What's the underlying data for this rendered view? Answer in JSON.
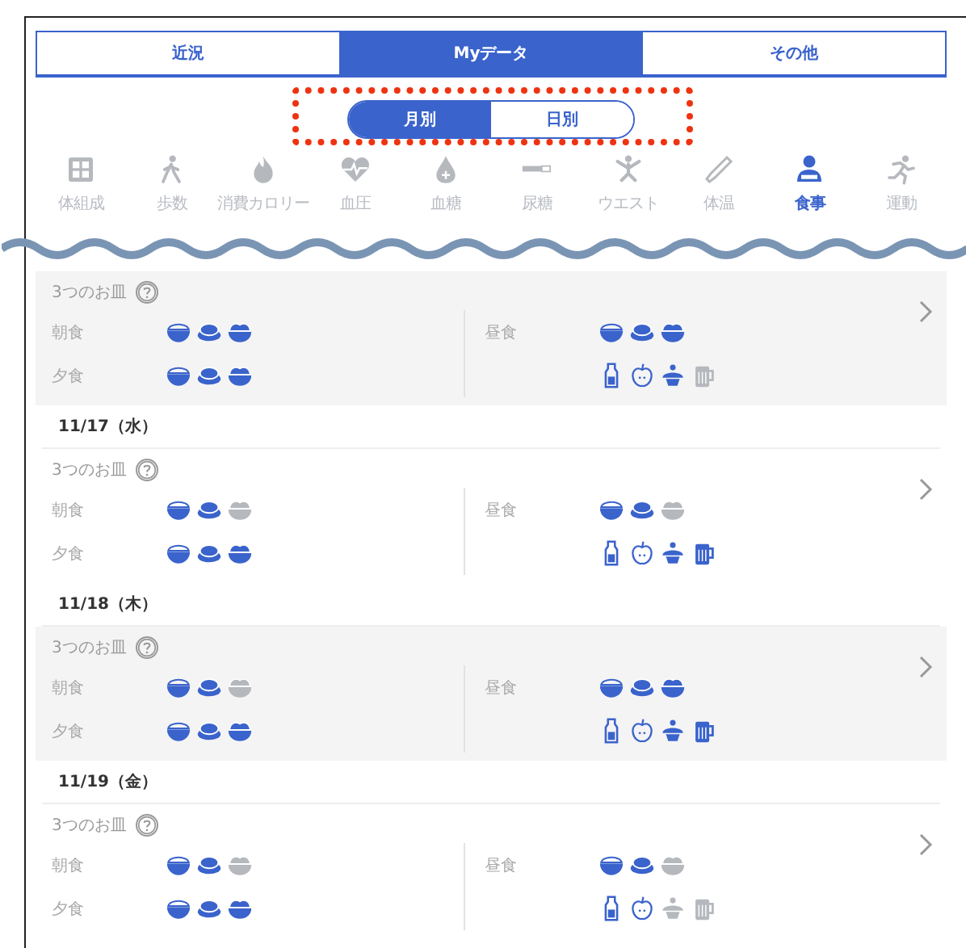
{
  "tabs": [
    {
      "label": "近況",
      "selected": false
    },
    {
      "label": "Myデータ",
      "selected": true
    },
    {
      "label": "その他",
      "selected": false
    }
  ],
  "period_toggle": [
    {
      "label": "月別",
      "selected": true
    },
    {
      "label": "日別",
      "selected": false
    }
  ],
  "categories": [
    {
      "label": "体組成",
      "kind": "scale",
      "selected": false
    },
    {
      "label": "歩数",
      "kind": "walk",
      "selected": false
    },
    {
      "label": "消費カロリー",
      "kind": "flame",
      "selected": false
    },
    {
      "label": "血圧",
      "kind": "heart",
      "selected": false
    },
    {
      "label": "血糖",
      "kind": "drop",
      "selected": false
    },
    {
      "label": "尿糖",
      "kind": "strip",
      "selected": false
    },
    {
      "label": "ウエスト",
      "kind": "waist",
      "selected": false
    },
    {
      "label": "体温",
      "kind": "thermo",
      "selected": false
    },
    {
      "label": "食事",
      "kind": "meal",
      "selected": true
    },
    {
      "label": "運動",
      "kind": "run",
      "selected": false
    }
  ],
  "days": [
    {
      "section_label": "3つのお皿",
      "breakfast": {
        "label": "朝食",
        "dishes": [
          {
            "kind": "rice",
            "on": true
          },
          {
            "kind": "main",
            "on": true
          },
          {
            "kind": "side",
            "on": true
          }
        ]
      },
      "lunch": {
        "label": "昼食",
        "dishes": [
          {
            "kind": "rice",
            "on": true
          },
          {
            "kind": "main",
            "on": true
          },
          {
            "kind": "side",
            "on": true
          }
        ]
      },
      "dinner": {
        "label": "夕食",
        "dishes": [
          {
            "kind": "rice",
            "on": true
          },
          {
            "kind": "main",
            "on": true
          },
          {
            "kind": "side",
            "on": true
          }
        ]
      },
      "extras": [
        {
          "kind": "milk",
          "on": true
        },
        {
          "kind": "fruit",
          "on": true
        },
        {
          "kind": "sweets",
          "on": true
        },
        {
          "kind": "alcohol",
          "on": false
        }
      ]
    },
    {
      "date": "11/17（水）",
      "section_label": "3つのお皿",
      "breakfast": {
        "label": "朝食",
        "dishes": [
          {
            "kind": "rice",
            "on": true
          },
          {
            "kind": "main",
            "on": true
          },
          {
            "kind": "side",
            "on": false
          }
        ]
      },
      "lunch": {
        "label": "昼食",
        "dishes": [
          {
            "kind": "rice",
            "on": true
          },
          {
            "kind": "main",
            "on": true
          },
          {
            "kind": "side",
            "on": false
          }
        ]
      },
      "dinner": {
        "label": "夕食",
        "dishes": [
          {
            "kind": "rice",
            "on": true
          },
          {
            "kind": "main",
            "on": true
          },
          {
            "kind": "side",
            "on": true
          }
        ]
      },
      "extras": [
        {
          "kind": "milk",
          "on": true
        },
        {
          "kind": "fruit",
          "on": true
        },
        {
          "kind": "sweets",
          "on": true
        },
        {
          "kind": "alcohol",
          "on": true
        }
      ]
    },
    {
      "date": "11/18（木）",
      "section_label": "3つのお皿",
      "breakfast": {
        "label": "朝食",
        "dishes": [
          {
            "kind": "rice",
            "on": true
          },
          {
            "kind": "main",
            "on": true
          },
          {
            "kind": "side",
            "on": false
          }
        ]
      },
      "lunch": {
        "label": "昼食",
        "dishes": [
          {
            "kind": "rice",
            "on": true
          },
          {
            "kind": "main",
            "on": true
          },
          {
            "kind": "side",
            "on": true
          }
        ]
      },
      "dinner": {
        "label": "夕食",
        "dishes": [
          {
            "kind": "rice",
            "on": true
          },
          {
            "kind": "main",
            "on": true
          },
          {
            "kind": "side",
            "on": true
          }
        ]
      },
      "extras": [
        {
          "kind": "milk",
          "on": true
        },
        {
          "kind": "fruit",
          "on": true
        },
        {
          "kind": "sweets",
          "on": true
        },
        {
          "kind": "alcohol",
          "on": true
        }
      ]
    },
    {
      "date": "11/19（金）",
      "section_label": "3つのお皿",
      "breakfast": {
        "label": "朝食",
        "dishes": [
          {
            "kind": "rice",
            "on": true
          },
          {
            "kind": "main",
            "on": true
          },
          {
            "kind": "side",
            "on": false
          }
        ]
      },
      "lunch": {
        "label": "昼食",
        "dishes": [
          {
            "kind": "rice",
            "on": true
          },
          {
            "kind": "main",
            "on": true
          },
          {
            "kind": "side",
            "on": false
          }
        ]
      },
      "dinner": {
        "label": "夕食",
        "dishes": [
          {
            "kind": "rice",
            "on": true
          },
          {
            "kind": "main",
            "on": true
          },
          {
            "kind": "side",
            "on": true
          }
        ]
      },
      "extras": [
        {
          "kind": "milk",
          "on": true
        },
        {
          "kind": "fruit",
          "on": true
        },
        {
          "kind": "sweets",
          "on": false
        },
        {
          "kind": "alcohol",
          "on": false
        }
      ]
    }
  ]
}
